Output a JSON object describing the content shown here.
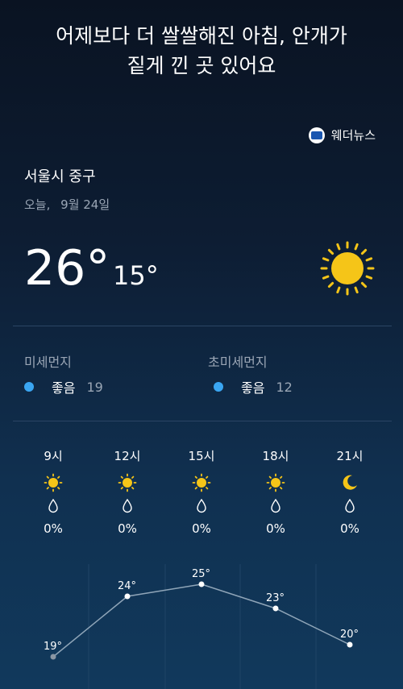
{
  "headline": {
    "line1": "어제보다 더 쌀쌀해진 아침, 안개가",
    "line2": "짙게 낀 곳 있어요"
  },
  "source": {
    "name": "웨더뉴스",
    "icon": "weathernews-logo"
  },
  "location": "서울시 중구",
  "date": {
    "day": "오늘,",
    "date": "9월 24일"
  },
  "temperature": {
    "high": "26°",
    "low": "15°",
    "icon": "sun-icon"
  },
  "dust": {
    "fine": {
      "label": "미세먼지",
      "grade": "좋음",
      "value": "19",
      "color": "#3aa6f2"
    },
    "ultrafine": {
      "label": "초미세먼지",
      "grade": "좋음",
      "value": "12",
      "color": "#3aa6f2"
    }
  },
  "hourly": [
    {
      "time": "9시",
      "icon": "sun-icon",
      "precip": "0%",
      "temp": "19°",
      "temp_value": 19
    },
    {
      "time": "12시",
      "icon": "sun-icon",
      "precip": "0%",
      "temp": "24°",
      "temp_value": 24
    },
    {
      "time": "15시",
      "icon": "sun-icon",
      "precip": "0%",
      "temp": "25°",
      "temp_value": 25
    },
    {
      "time": "18시",
      "icon": "sun-icon",
      "precip": "0%",
      "temp": "23°",
      "temp_value": 23
    },
    {
      "time": "21시",
      "icon": "moon-icon",
      "precip": "0%",
      "temp": "20°",
      "temp_value": 20
    }
  ],
  "colors": {
    "sun": "#f5c518",
    "accent": "#3aa6f2",
    "muted": "#9aa6b5"
  }
}
